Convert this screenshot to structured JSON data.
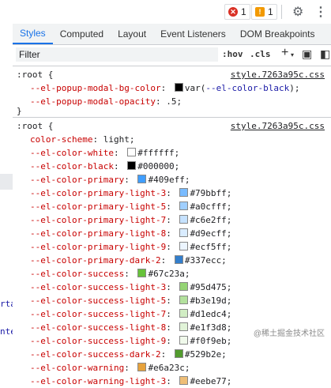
{
  "toolbar": {
    "error_count": "1",
    "warning_count": "1"
  },
  "tabs": [
    {
      "label": "Styles",
      "active": true
    },
    {
      "label": "Computed",
      "active": false
    },
    {
      "label": "Layout",
      "active": false
    },
    {
      "label": "Event Listeners",
      "active": false
    },
    {
      "label": "DOM Breakpoints",
      "active": false
    }
  ],
  "filter": {
    "placeholder": "Filter",
    "hov_label": ":hov",
    "cls_label": ".cls",
    "plus_label": "+"
  },
  "left_fragments": [
    "rta",
    "nte"
  ],
  "rule1": {
    "selector": ":root {",
    "source": "style.7263a95c.css",
    "close": "}",
    "declarations": [
      {
        "name": "--el-popup-modal-bg-color",
        "value_prefix": "var(",
        "value_var": "--el-color-black",
        "value_suffix": ");",
        "swatch": "#000000"
      },
      {
        "name": "--el-popup-modal-opacity",
        "value": ".5;"
      }
    ]
  },
  "rule2": {
    "selector": ":root {",
    "source": "style.7263a95c.css",
    "declarations": [
      {
        "name": "color-scheme",
        "value": "light;"
      },
      {
        "name": "--el-color-white",
        "value": "#ffffff;",
        "swatch": "#ffffff"
      },
      {
        "name": "--el-color-black",
        "value": "#000000;",
        "swatch": "#000000"
      },
      {
        "name": "--el-color-primary",
        "value": "#409eff;",
        "swatch": "#409eff"
      },
      {
        "name": "--el-color-primary-light-3",
        "value": "#79bbff;",
        "swatch": "#79bbff"
      },
      {
        "name": "--el-color-primary-light-5",
        "value": "#a0cfff;",
        "swatch": "#a0cfff"
      },
      {
        "name": "--el-color-primary-light-7",
        "value": "#c6e2ff;",
        "swatch": "#c6e2ff"
      },
      {
        "name": "--el-color-primary-light-8",
        "value": "#d9ecff;",
        "swatch": "#d9ecff"
      },
      {
        "name": "--el-color-primary-light-9",
        "value": "#ecf5ff;",
        "swatch": "#ecf5ff"
      },
      {
        "name": "--el-color-primary-dark-2",
        "value": "#337ecc;",
        "swatch": "#337ecc"
      },
      {
        "name": "--el-color-success",
        "value": "#67c23a;",
        "swatch": "#67c23a"
      },
      {
        "name": "--el-color-success-light-3",
        "value": "#95d475;",
        "swatch": "#95d475"
      },
      {
        "name": "--el-color-success-light-5",
        "value": "#b3e19d;",
        "swatch": "#b3e19d"
      },
      {
        "name": "--el-color-success-light-7",
        "value": "#d1edc4;",
        "swatch": "#d1edc4"
      },
      {
        "name": "--el-color-success-light-8",
        "value": "#e1f3d8;",
        "swatch": "#e1f3d8"
      },
      {
        "name": "--el-color-success-light-9",
        "value": "#f0f9eb;",
        "swatch": "#f0f9eb"
      },
      {
        "name": "--el-color-success-dark-2",
        "value": "#529b2e;",
        "swatch": "#529b2e"
      },
      {
        "name": "--el-color-warning",
        "value": "#e6a23c;",
        "swatch": "#e6a23c"
      },
      {
        "name": "--el-color-warning-light-3",
        "value": "#eebe77;",
        "swatch": "#eebe77"
      }
    ]
  },
  "watermark": "@稀土掘金技术社区"
}
